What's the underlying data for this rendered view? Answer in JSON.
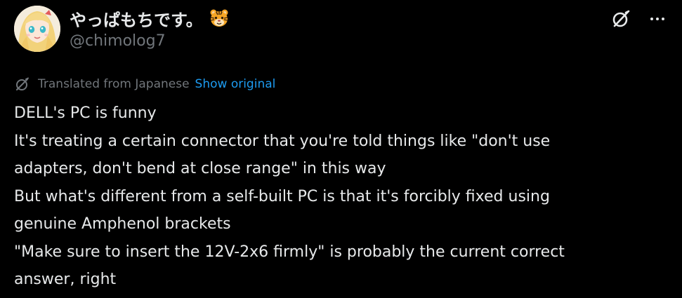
{
  "post": {
    "display_name": "やっぱもちです。",
    "handle": "@chimolog7",
    "translation": {
      "label": "Translated from Japanese",
      "link": "Show original"
    },
    "body_lines": [
      "DELL's PC is funny",
      "It's treating a certain connector that you're told things like \"don't use",
      "adapters, don't bend at close range\" in this way",
      "But what's different from a self-built PC is that it's forcibly fixed using",
      "genuine Amphenol brackets",
      "\"Make sure to insert the 12V-2x6 firmly\" is probably the current correct",
      "answer, right"
    ]
  },
  "icons": {
    "avatar": "anime-girl-avatar",
    "badge": "tiger-face-emoji",
    "grok": "grok-icon",
    "more": "more-dots-icon",
    "translate": "grok-translate-icon"
  },
  "colors": {
    "background": "#000000",
    "text": "#e7e9ea",
    "muted": "#71767b",
    "link": "#1d9bf0"
  }
}
